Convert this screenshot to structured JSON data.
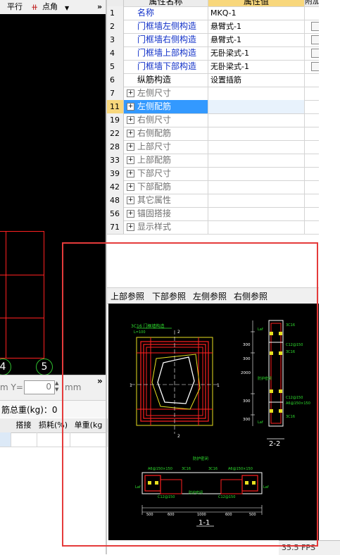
{
  "left_toolbar": {
    "parallel_label": "平行",
    "point_angle_label": "点角",
    "more_glyph": "»"
  },
  "axis_numbers": [
    "4",
    "5"
  ],
  "coord_bar": {
    "suffix_label": "m Y=",
    "y_value": "0",
    "unit": "mm",
    "more_glyph": "»"
  },
  "weight_bar": {
    "label": "筋总重(kg)：0"
  },
  "mini_table": {
    "headers": [
      "搭接",
      "损耗(%)",
      "单重(kg"
    ]
  },
  "property_grid": {
    "header": {
      "name": "属性名称",
      "value": "属性值",
      "attach": "附加"
    },
    "rows": [
      {
        "num": "1",
        "name": "名称",
        "value": "MKQ-1",
        "style": "blue",
        "expander": false,
        "checkbox": false
      },
      {
        "num": "2",
        "name": "门框墙左侧构造",
        "value": "悬臂式-1",
        "style": "blue",
        "expander": false,
        "checkbox": true
      },
      {
        "num": "3",
        "name": "门框墙右侧构造",
        "value": "悬臂式-1",
        "style": "blue",
        "expander": false,
        "checkbox": true
      },
      {
        "num": "4",
        "name": "门框墙上部构造",
        "value": "无卧梁式-1",
        "style": "blue",
        "expander": false,
        "checkbox": true
      },
      {
        "num": "5",
        "name": "门框墙下部构造",
        "value": "无卧梁式-1",
        "style": "blue",
        "expander": false,
        "checkbox": true
      },
      {
        "num": "6",
        "name": "纵筋构造",
        "value": "设置插筋",
        "style": "black",
        "expander": false,
        "checkbox": false
      },
      {
        "num": "7",
        "name": "左侧尺寸",
        "value": "",
        "style": "gray",
        "expander": true,
        "checkbox": false
      },
      {
        "num": "11",
        "name": "左侧配筋",
        "value": "",
        "style": "selected",
        "expander": true,
        "checkbox": false
      },
      {
        "num": "19",
        "name": "右侧尺寸",
        "value": "",
        "style": "gray",
        "expander": true,
        "checkbox": false
      },
      {
        "num": "22",
        "name": "右侧配筋",
        "value": "",
        "style": "gray",
        "expander": true,
        "checkbox": false
      },
      {
        "num": "28",
        "name": "上部尺寸",
        "value": "",
        "style": "gray",
        "expander": true,
        "checkbox": false
      },
      {
        "num": "33",
        "name": "上部配筋",
        "value": "",
        "style": "gray",
        "expander": true,
        "checkbox": false
      },
      {
        "num": "39",
        "name": "下部尺寸",
        "value": "",
        "style": "gray",
        "expander": true,
        "checkbox": false
      },
      {
        "num": "42",
        "name": "下部配筋",
        "value": "",
        "style": "gray",
        "expander": true,
        "checkbox": false
      },
      {
        "num": "48",
        "name": "其它属性",
        "value": "",
        "style": "gray",
        "expander": true,
        "checkbox": false
      },
      {
        "num": "56",
        "name": "锚固搭接",
        "value": "",
        "style": "gray",
        "expander": true,
        "checkbox": false
      },
      {
        "num": "71",
        "name": "显示样式",
        "value": "",
        "style": "gray",
        "expander": true,
        "checkbox": false
      }
    ]
  },
  "ref_tabs": [
    "上部参照",
    "下部参照",
    "左侧参照",
    "右侧参照"
  ],
  "cad": {
    "plan_note": "3C16 门框墙构造",
    "plan_sub": "L=100",
    "sec_marks": [
      "2",
      "2",
      "1",
      "1"
    ],
    "elev_dims": [
      "300",
      "300",
      "2000",
      "300",
      "300"
    ],
    "elev_labels": [
      "Laf",
      "3C16",
      "C12@150",
      "3C16",
      "防护密闭",
      "C12@150",
      "A6@150×150",
      "3C16",
      "Laf"
    ],
    "elev_title": "2-2",
    "plan2_title": "防护密闭",
    "plan2_labels": [
      "A6@150×150",
      "3C16",
      "3C16",
      "A6@150×150",
      "C12@150",
      "C12@150",
      "防护密闭",
      "Laf",
      "Laf"
    ],
    "plan2_dims": [
      "500",
      "600",
      "1000",
      "600",
      "500"
    ],
    "plan2_caption": "1-1"
  },
  "status": {
    "fps": "35.5 FPS"
  },
  "colors": {
    "canvas_bg": "#000000",
    "rebar_red": "#ff2020",
    "cad_yellow": "#e8e020",
    "cad_green": "#2fe02f",
    "cad_white": "#ffffff",
    "selection_blue": "#3399ff",
    "highlight_red": "#e53b3b",
    "link_blue": "#1030c8"
  }
}
